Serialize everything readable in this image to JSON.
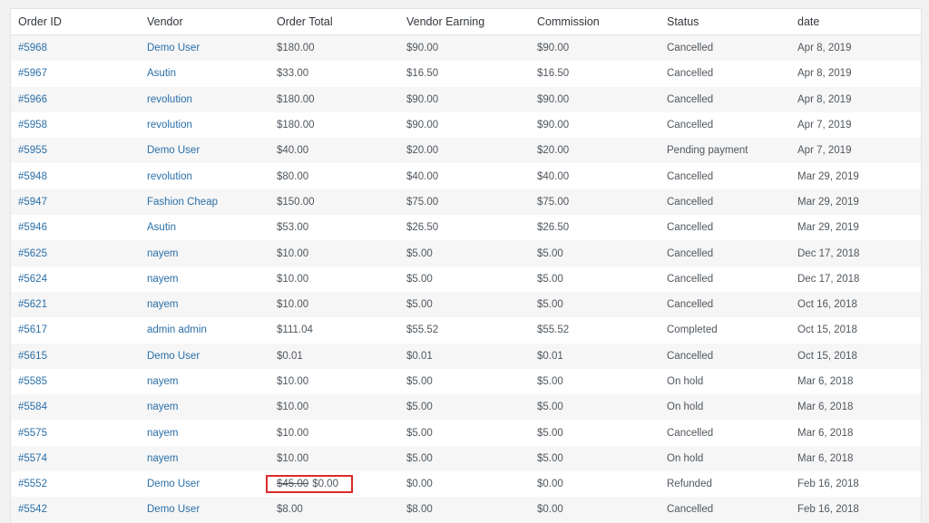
{
  "table": {
    "columns": [
      "Order ID",
      "Vendor",
      "Order Total",
      "Vendor Earning",
      "Commission",
      "Status",
      "date"
    ],
    "rows": [
      {
        "order_id": "#5968",
        "vendor": "Demo User",
        "order_total": "$180.00",
        "vendor_earning": "$90.00",
        "commission": "$90.00",
        "status": "Cancelled",
        "date": "Apr 8, 2019"
      },
      {
        "order_id": "#5967",
        "vendor": "Asutin",
        "order_total": "$33.00",
        "vendor_earning": "$16.50",
        "commission": "$16.50",
        "status": "Cancelled",
        "date": "Apr 8, 2019"
      },
      {
        "order_id": "#5966",
        "vendor": "revolution",
        "order_total": "$180.00",
        "vendor_earning": "$90.00",
        "commission": "$90.00",
        "status": "Cancelled",
        "date": "Apr 8, 2019"
      },
      {
        "order_id": "#5958",
        "vendor": "revolution",
        "order_total": "$180.00",
        "vendor_earning": "$90.00",
        "commission": "$90.00",
        "status": "Cancelled",
        "date": "Apr 7, 2019"
      },
      {
        "order_id": "#5955",
        "vendor": "Demo User",
        "order_total": "$40.00",
        "vendor_earning": "$20.00",
        "commission": "$20.00",
        "status": "Pending payment",
        "date": "Apr 7, 2019"
      },
      {
        "order_id": "#5948",
        "vendor": "revolution",
        "order_total": "$80.00",
        "vendor_earning": "$40.00",
        "commission": "$40.00",
        "status": "Cancelled",
        "date": "Mar 29, 2019"
      },
      {
        "order_id": "#5947",
        "vendor": "Fashion Cheap",
        "order_total": "$150.00",
        "vendor_earning": "$75.00",
        "commission": "$75.00",
        "status": "Cancelled",
        "date": "Mar 29, 2019"
      },
      {
        "order_id": "#5946",
        "vendor": "Asutin",
        "order_total": "$53.00",
        "vendor_earning": "$26.50",
        "commission": "$26.50",
        "status": "Cancelled",
        "date": "Mar 29, 2019"
      },
      {
        "order_id": "#5625",
        "vendor": "nayem",
        "order_total": "$10.00",
        "vendor_earning": "$5.00",
        "commission": "$5.00",
        "status": "Cancelled",
        "date": "Dec 17, 2018"
      },
      {
        "order_id": "#5624",
        "vendor": "nayem",
        "order_total": "$10.00",
        "vendor_earning": "$5.00",
        "commission": "$5.00",
        "status": "Cancelled",
        "date": "Dec 17, 2018"
      },
      {
        "order_id": "#5621",
        "vendor": "nayem",
        "order_total": "$10.00",
        "vendor_earning": "$5.00",
        "commission": "$5.00",
        "status": "Cancelled",
        "date": "Oct 16, 2018"
      },
      {
        "order_id": "#5617",
        "vendor": "admin admin",
        "order_total": "$111.04",
        "vendor_earning": "$55.52",
        "commission": "$55.52",
        "status": "Completed",
        "date": "Oct 15, 2018"
      },
      {
        "order_id": "#5615",
        "vendor": "Demo User",
        "order_total": "$0.01",
        "vendor_earning": "$0.01",
        "commission": "$0.01",
        "status": "Cancelled",
        "date": "Oct 15, 2018"
      },
      {
        "order_id": "#5585",
        "vendor": "nayem",
        "order_total": "$10.00",
        "vendor_earning": "$5.00",
        "commission": "$5.00",
        "status": "On hold",
        "date": "Mar 6, 2018"
      },
      {
        "order_id": "#5584",
        "vendor": "nayem",
        "order_total": "$10.00",
        "vendor_earning": "$5.00",
        "commission": "$5.00",
        "status": "On hold",
        "date": "Mar 6, 2018"
      },
      {
        "order_id": "#5575",
        "vendor": "nayem",
        "order_total": "$10.00",
        "vendor_earning": "$5.00",
        "commission": "$5.00",
        "status": "Cancelled",
        "date": "Mar 6, 2018"
      },
      {
        "order_id": "#5574",
        "vendor": "nayem",
        "order_total": "$10.00",
        "vendor_earning": "$5.00",
        "commission": "$5.00",
        "status": "On hold",
        "date": "Mar 6, 2018"
      },
      {
        "order_id": "#5552",
        "vendor": "Demo User",
        "order_total": "$0.00",
        "order_total_original": "$45.00",
        "highlighted": true,
        "vendor_earning": "$0.00",
        "commission": "$0.00",
        "status": "Refunded",
        "date": "Feb 16, 2018"
      },
      {
        "order_id": "#5542",
        "vendor": "Demo User",
        "order_total": "$8.00",
        "vendor_earning": "$8.00",
        "commission": "$0.00",
        "status": "Cancelled",
        "date": "Feb 16, 2018"
      }
    ]
  },
  "colors": {
    "link": "#2a6fa8",
    "highlight_border": "#d92b2b",
    "page_background": "#f1f1f1",
    "stripe": "#f6f6f6"
  }
}
